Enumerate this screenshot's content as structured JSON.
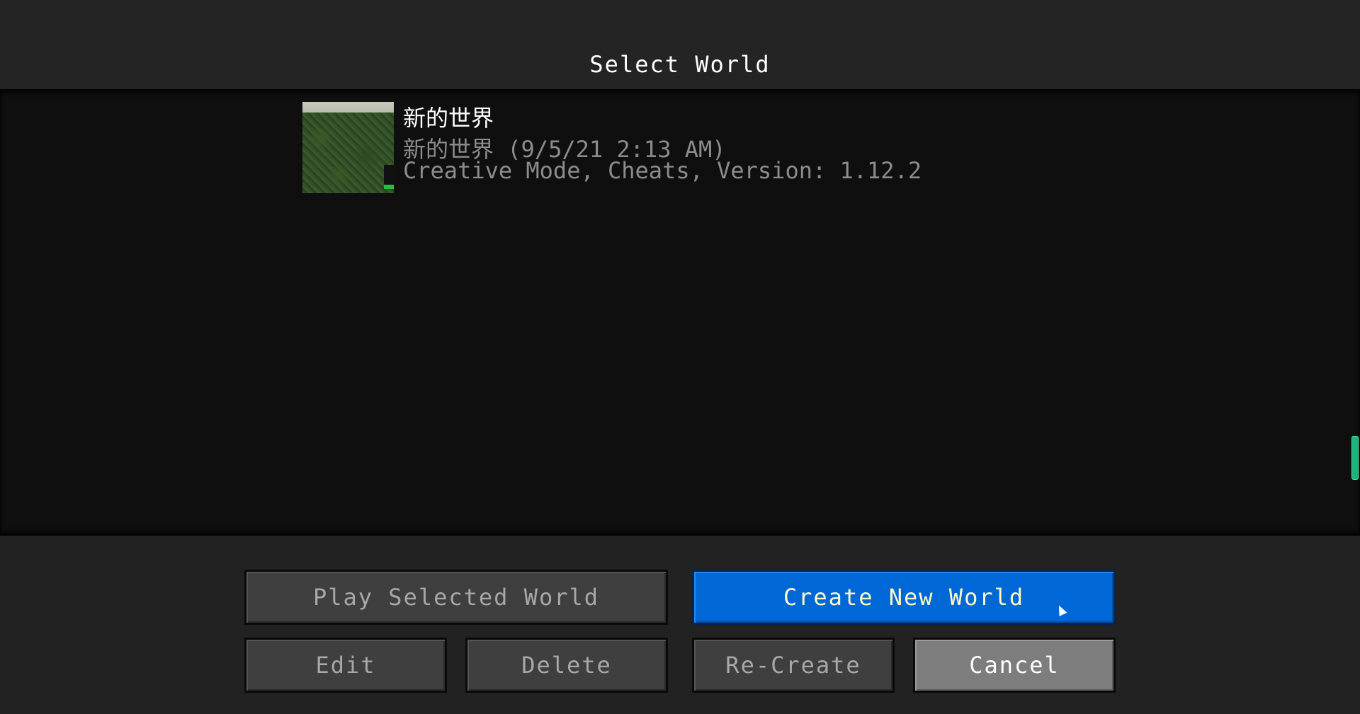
{
  "screen": {
    "title": "Select World"
  },
  "worlds": [
    {
      "name": "新的世界",
      "subtitle": "新的世界 (9/5/21 2:13 AM)",
      "details": "Creative Mode, Cheats, Version: 1.12.2"
    }
  ],
  "buttons": {
    "play_selected": "Play Selected World",
    "create_new": "Create New World",
    "edit": "Edit",
    "delete": "Delete",
    "recreate": "Re-Create",
    "cancel": "Cancel"
  },
  "colors": {
    "primary_button": "#0068d6",
    "primary_text": "#fff9c8",
    "scrollbar": "#19b57a"
  },
  "icons": {
    "cursor": "mouse-pointer-icon"
  }
}
